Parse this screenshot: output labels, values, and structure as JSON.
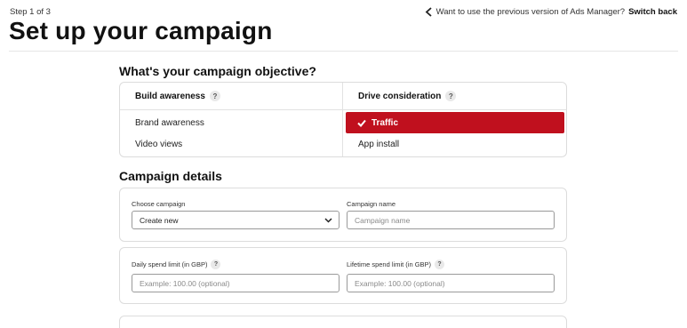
{
  "header": {
    "step": "Step 1 of 3",
    "title": "Set up your campaign",
    "switch_prompt": "Want to use the previous version of Ads Manager?",
    "switch_link": "Switch back"
  },
  "objective": {
    "title": "What's your campaign objective?",
    "columns": [
      {
        "label": "Build awareness",
        "items": [
          "Brand awareness",
          "Video views"
        ]
      },
      {
        "label": "Drive consideration",
        "items": [
          "Traffic",
          "App install"
        ]
      }
    ],
    "selected": "Traffic",
    "help_glyph": "?"
  },
  "details": {
    "title": "Campaign details",
    "choose_campaign": {
      "label": "Choose campaign",
      "value": "Create new"
    },
    "campaign_name": {
      "label": "Campaign name",
      "placeholder": "Campaign name"
    },
    "daily_limit": {
      "label": "Daily spend limit (in GBP)",
      "placeholder": "Example: 100.00 (optional)"
    },
    "lifetime_limit": {
      "label": "Lifetime spend limit (in GBP)",
      "placeholder": "Example: 100.00 (optional)"
    }
  },
  "colors": {
    "accent": "#c0101e"
  }
}
